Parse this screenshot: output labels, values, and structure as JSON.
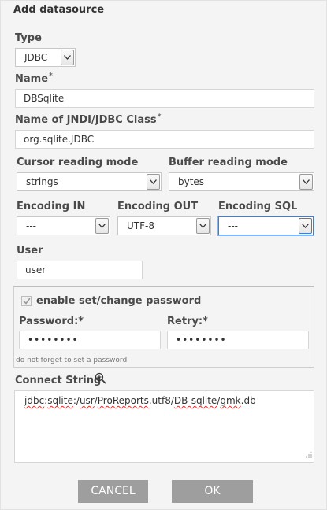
{
  "dialog": {
    "title": "Add datasource"
  },
  "type": {
    "label": "Type",
    "value": "JDBC"
  },
  "name": {
    "label": "Name",
    "required_mark": "*",
    "value": "DBSqlite"
  },
  "jndi_class": {
    "label": "Name of JNDI/JDBC Class",
    "required_mark": "*",
    "value": "org.sqlite.JDBC"
  },
  "cursor_mode": {
    "label": "Cursor reading mode",
    "value": "strings"
  },
  "buffer_mode": {
    "label": "Buffer reading mode",
    "value": "bytes"
  },
  "encoding_in": {
    "label": "Encoding IN",
    "value": "---"
  },
  "encoding_out": {
    "label": "Encoding OUT",
    "value": "UTF-8"
  },
  "encoding_sql": {
    "label": "Encoding SQL",
    "value": "---"
  },
  "user": {
    "label": "User",
    "value": "user"
  },
  "password_section": {
    "checkbox_label": "enable set/change password",
    "checked": true,
    "password_label": "Password:*",
    "password_value": "••••••••",
    "retry_label": "Retry:*",
    "retry_value": "••••••••",
    "hint": "do not forget to set a password"
  },
  "connect_string": {
    "label": "Connect String",
    "parts": [
      "jdbc",
      ":",
      "sqlite",
      ":/",
      "usr",
      "/",
      "ProReports",
      ".utf8/",
      "DB-sqlite",
      "/",
      "gmk",
      ".db"
    ]
  },
  "buttons": {
    "cancel": "CANCEL",
    "ok": "OK"
  },
  "icons": {
    "zoom": "zoom-in-icon",
    "dropdown": "chevron-down-icon",
    "check": "check-icon",
    "resize": "resize-grip-icon"
  }
}
